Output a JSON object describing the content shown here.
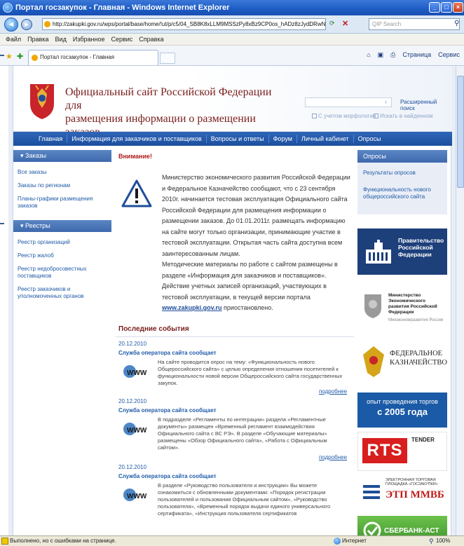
{
  "window": {
    "title": "Портал госзакупок - Главная - Windows Internet Explorer",
    "url": "http://zakupki.gov.ru/wps/portal/base/home/!ut/p/c5/04_SB8K8xLLM9MSSzPy8xBz9CP0os_hADz8zJydDRwN39yBTA09vzzCxwABvAwMDE3M",
    "search_placeholder": "QIP Search",
    "tab_label": "Портал госзакупок - Главная",
    "menu": [
      "Файл",
      "Правка",
      "Вид",
      "Избранное",
      "Сервис",
      "Справка"
    ],
    "toolbar_right": [
      "Страница",
      "Сервис"
    ]
  },
  "site": {
    "title_line1": "Официальный сайт Российской Федерации для",
    "title_line2": "размещения информации о размещении заказов",
    "advanced_search": "Расширенный поиск",
    "morphology_label": "С учетом морфологии",
    "search_in_found_label": "Искать в найденном",
    "nav": [
      "Главная",
      "Информация для заказчиков и поставщиков",
      "Вопросы и ответы",
      "Форум",
      "Личный кабинет",
      "Опросы"
    ]
  },
  "left": {
    "orders_head": "▾ Заказы",
    "orders": [
      "Все заказы",
      "Заказы по регионам",
      "Планы-графики размещения заказов"
    ],
    "registries_head": "▾ Реестры",
    "registries": [
      "Реестр организаций",
      "Реестр жалоб",
      "Реестр недобросовестных поставщиков",
      "Реестр заказчиков и уполномоченных органов"
    ]
  },
  "notice": {
    "title": "Внимание!",
    "text1": "Министерство экономического развития Российской Федерации и Федеральное Казначейство сообщают, что с 23 сентября 2010г. начинается тестовая эксплуатация Официального сайта Российской Федерации для размещения информации о размещении заказов. До 01.01.2011г. размещать информацию на сайте могут только организации, принимающие участие в тестовой эксплуатации. Открытая часть сайта доступна всем заинтересованным лицам.",
    "text2": "Методические материалы по работе с сайтом размещены в разделе «Информация для заказчиков и поставщиков».",
    "text3": "Действие учетных записей организаций, участвующих в тестовой эксплуатации, в текущей версии портала",
    "link": "www.zakupki.gov.ru",
    "text4": "приостановлено."
  },
  "events": {
    "title": "Последние события",
    "items": [
      {
        "date": "20.12.2010",
        "head": "Служба оператора сайта сообщает",
        "body": "На сайте проводится опрос на тему: «Функциональность нового Общероссийского сайта» с целью определения отношения посетителей к функциональности новой версии Общероссийского сайта государственных закупок.",
        "more": "подробнее"
      },
      {
        "date": "20.12.2010",
        "head": "Служба оператора сайта сообщает",
        "body": "В подразделе «Регламенты по интеграции» раздела «Регламентные документы» размещен «Временный регламент взаимодействия Официального сайта с ВС РЭ». В разделе «Обучающие материалы» размещены «Обзор Официального сайта», «Работа с Официальным сайтом».",
        "more": "подробнее"
      },
      {
        "date": "20.12.2010",
        "head": "Служба оператора сайта сообщает",
        "body": "В разделе «Руководство пользователя и инструкции» Вы можете ознакомиться с обновленными документами: «Порядок регистрации пользователей и пользования Официальным сайтом», «Руководство пользователя», «Временный порядок выдачи единого универсального сертификата», «Инструкция пользователя сертификатов",
        "more": ""
      }
    ],
    "logo_text": "WWW"
  },
  "right": {
    "polls_head": "Опросы",
    "polls": [
      "Результаты опросов",
      "Функциональность нового общероссийского сайта"
    ],
    "gov_banner": "Правительство Российской Федерации",
    "min_banner": "Министерство Экономического развития Российской Федерации",
    "min_sub": "Минэкономразвития России",
    "kazn_banner": "ФЕДЕРАЛЬНОЕ КАЗНАЧЕЙСТВО",
    "torg_line1": "опыт проведения торгов",
    "torg_line2": "с 2005 года",
    "rts": "RTS",
    "tender": "TENDER",
    "ett_small": "ЭЛЕКТРОННАЯ ТОРГОВАЯ ПЛОЩАДКА «ГОСЗАКУПКИ»",
    "ett_big": "ЭТП ММВБ",
    "sber": "СБЕРБАНК-АСТ"
  },
  "status": {
    "text": "Выполнено, но с ошибками на странице.",
    "zone": "Интернет",
    "zoom": "100%"
  }
}
